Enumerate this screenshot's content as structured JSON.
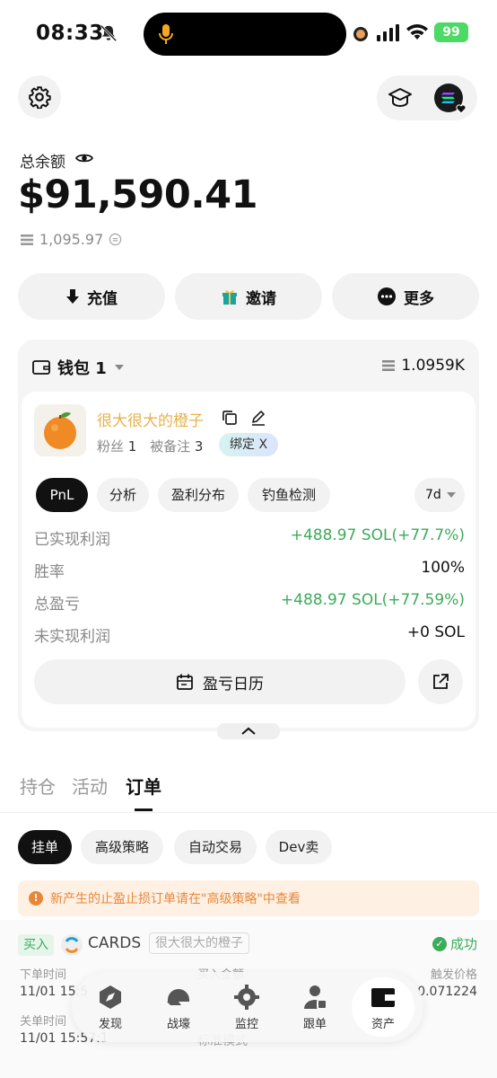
{
  "status_bar": {
    "time": "08:33",
    "battery": "99"
  },
  "balance": {
    "label": "总余额",
    "amount": "$91,590.41",
    "sol_amount": "1,095.97"
  },
  "actions": [
    {
      "label": "充值",
      "icon": "deposit-icon"
    },
    {
      "label": "邀请",
      "icon": "gift-icon"
    },
    {
      "label": "更多",
      "icon": "more-icon"
    }
  ],
  "wallet": {
    "name": "钱包 1",
    "value": "1.0959K",
    "profile": {
      "username": "很大很大的橙子",
      "fans_label": "粉丝",
      "fans": "1",
      "noted_label": "被备注",
      "noted": "3",
      "bind_label": "绑定 X"
    },
    "tabs": [
      "PnL",
      "分析",
      "盈利分布",
      "钓鱼检测"
    ],
    "active_tab": "PnL",
    "period": "7d",
    "stats": [
      {
        "label": "已实现利润",
        "value": "+488.97 SOL(+77.7%)",
        "tone": "green"
      },
      {
        "label": "胜率",
        "value": "100%",
        "tone": "neutral"
      },
      {
        "label": "总盈亏",
        "value": "+488.97 SOL(+77.59%)",
        "tone": "green"
      },
      {
        "label": "未实现利润",
        "value": "+0 SOL",
        "tone": "neutral"
      }
    ],
    "calendar_label": "盈亏日历"
  },
  "main_tabs": [
    "持仓",
    "活动",
    "订单"
  ],
  "active_main_tab": "订单",
  "order_tabs": [
    "挂单",
    "高级策略",
    "自动交易",
    "Dev卖"
  ],
  "active_order_tab": "挂单",
  "notice": "新产生的止盈止损订单请在\"高级策略\"中查看",
  "order": {
    "side": "买入",
    "token": "CARDS",
    "owner": "很大很大的橙子",
    "status": "成功",
    "order_time_label": "下单时间",
    "order_time": "11/01 15:5",
    "buy_amount_label": "买入金额",
    "trigger_price_label": "触发价格",
    "trigger_price": "0.071224",
    "close_time_label": "关单时间",
    "close_time": "11/01 15:57:1",
    "mode": "标准模式"
  },
  "nav": [
    {
      "label": "发现",
      "icon": "discover-icon"
    },
    {
      "label": "战壕",
      "icon": "helmet-icon"
    },
    {
      "label": "监控",
      "icon": "monitor-icon"
    },
    {
      "label": "跟单",
      "icon": "copytrade-icon"
    },
    {
      "label": "资产",
      "icon": "wallet-icon"
    }
  ],
  "active_nav": "资产",
  "colors": {
    "profit_green": "#3cab5b",
    "username_gold": "#e7b24e",
    "notice_orange": "#e6883a"
  }
}
